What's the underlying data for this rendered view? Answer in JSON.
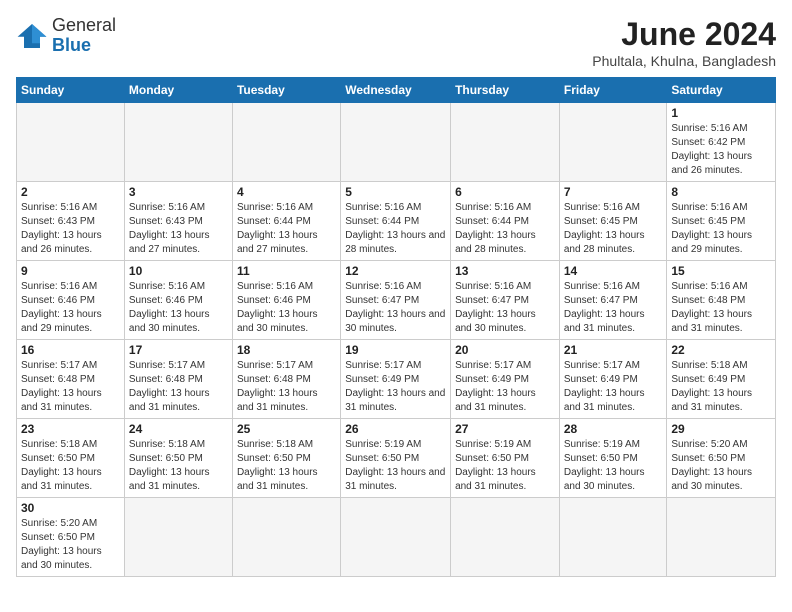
{
  "logo": {
    "text_general": "General",
    "text_blue": "Blue"
  },
  "calendar": {
    "title": "June 2024",
    "subtitle": "Phultala, Khulna, Bangladesh",
    "days_header": [
      "Sunday",
      "Monday",
      "Tuesday",
      "Wednesday",
      "Thursday",
      "Friday",
      "Saturday"
    ],
    "weeks": [
      [
        {
          "day": "",
          "info": ""
        },
        {
          "day": "",
          "info": ""
        },
        {
          "day": "",
          "info": ""
        },
        {
          "day": "",
          "info": ""
        },
        {
          "day": "",
          "info": ""
        },
        {
          "day": "",
          "info": ""
        },
        {
          "day": "1",
          "info": "Sunrise: 5:16 AM\nSunset: 6:42 PM\nDaylight: 13 hours and 26 minutes."
        }
      ],
      [
        {
          "day": "2",
          "info": "Sunrise: 5:16 AM\nSunset: 6:43 PM\nDaylight: 13 hours and 26 minutes."
        },
        {
          "day": "3",
          "info": "Sunrise: 5:16 AM\nSunset: 6:43 PM\nDaylight: 13 hours and 27 minutes."
        },
        {
          "day": "4",
          "info": "Sunrise: 5:16 AM\nSunset: 6:44 PM\nDaylight: 13 hours and 27 minutes."
        },
        {
          "day": "5",
          "info": "Sunrise: 5:16 AM\nSunset: 6:44 PM\nDaylight: 13 hours and 28 minutes."
        },
        {
          "day": "6",
          "info": "Sunrise: 5:16 AM\nSunset: 6:44 PM\nDaylight: 13 hours and 28 minutes."
        },
        {
          "day": "7",
          "info": "Sunrise: 5:16 AM\nSunset: 6:45 PM\nDaylight: 13 hours and 28 minutes."
        },
        {
          "day": "8",
          "info": "Sunrise: 5:16 AM\nSunset: 6:45 PM\nDaylight: 13 hours and 29 minutes."
        }
      ],
      [
        {
          "day": "9",
          "info": "Sunrise: 5:16 AM\nSunset: 6:46 PM\nDaylight: 13 hours and 29 minutes."
        },
        {
          "day": "10",
          "info": "Sunrise: 5:16 AM\nSunset: 6:46 PM\nDaylight: 13 hours and 30 minutes."
        },
        {
          "day": "11",
          "info": "Sunrise: 5:16 AM\nSunset: 6:46 PM\nDaylight: 13 hours and 30 minutes."
        },
        {
          "day": "12",
          "info": "Sunrise: 5:16 AM\nSunset: 6:47 PM\nDaylight: 13 hours and 30 minutes."
        },
        {
          "day": "13",
          "info": "Sunrise: 5:16 AM\nSunset: 6:47 PM\nDaylight: 13 hours and 30 minutes."
        },
        {
          "day": "14",
          "info": "Sunrise: 5:16 AM\nSunset: 6:47 PM\nDaylight: 13 hours and 31 minutes."
        },
        {
          "day": "15",
          "info": "Sunrise: 5:16 AM\nSunset: 6:48 PM\nDaylight: 13 hours and 31 minutes."
        }
      ],
      [
        {
          "day": "16",
          "info": "Sunrise: 5:17 AM\nSunset: 6:48 PM\nDaylight: 13 hours and 31 minutes."
        },
        {
          "day": "17",
          "info": "Sunrise: 5:17 AM\nSunset: 6:48 PM\nDaylight: 13 hours and 31 minutes."
        },
        {
          "day": "18",
          "info": "Sunrise: 5:17 AM\nSunset: 6:48 PM\nDaylight: 13 hours and 31 minutes."
        },
        {
          "day": "19",
          "info": "Sunrise: 5:17 AM\nSunset: 6:49 PM\nDaylight: 13 hours and 31 minutes."
        },
        {
          "day": "20",
          "info": "Sunrise: 5:17 AM\nSunset: 6:49 PM\nDaylight: 13 hours and 31 minutes."
        },
        {
          "day": "21",
          "info": "Sunrise: 5:17 AM\nSunset: 6:49 PM\nDaylight: 13 hours and 31 minutes."
        },
        {
          "day": "22",
          "info": "Sunrise: 5:18 AM\nSunset: 6:49 PM\nDaylight: 13 hours and 31 minutes."
        }
      ],
      [
        {
          "day": "23",
          "info": "Sunrise: 5:18 AM\nSunset: 6:50 PM\nDaylight: 13 hours and 31 minutes."
        },
        {
          "day": "24",
          "info": "Sunrise: 5:18 AM\nSunset: 6:50 PM\nDaylight: 13 hours and 31 minutes."
        },
        {
          "day": "25",
          "info": "Sunrise: 5:18 AM\nSunset: 6:50 PM\nDaylight: 13 hours and 31 minutes."
        },
        {
          "day": "26",
          "info": "Sunrise: 5:19 AM\nSunset: 6:50 PM\nDaylight: 13 hours and 31 minutes."
        },
        {
          "day": "27",
          "info": "Sunrise: 5:19 AM\nSunset: 6:50 PM\nDaylight: 13 hours and 31 minutes."
        },
        {
          "day": "28",
          "info": "Sunrise: 5:19 AM\nSunset: 6:50 PM\nDaylight: 13 hours and 30 minutes."
        },
        {
          "day": "29",
          "info": "Sunrise: 5:20 AM\nSunset: 6:50 PM\nDaylight: 13 hours and 30 minutes."
        }
      ],
      [
        {
          "day": "30",
          "info": "Sunrise: 5:20 AM\nSunset: 6:50 PM\nDaylight: 13 hours and 30 minutes."
        },
        {
          "day": "",
          "info": ""
        },
        {
          "day": "",
          "info": ""
        },
        {
          "day": "",
          "info": ""
        },
        {
          "day": "",
          "info": ""
        },
        {
          "day": "",
          "info": ""
        },
        {
          "day": "",
          "info": ""
        }
      ]
    ]
  }
}
